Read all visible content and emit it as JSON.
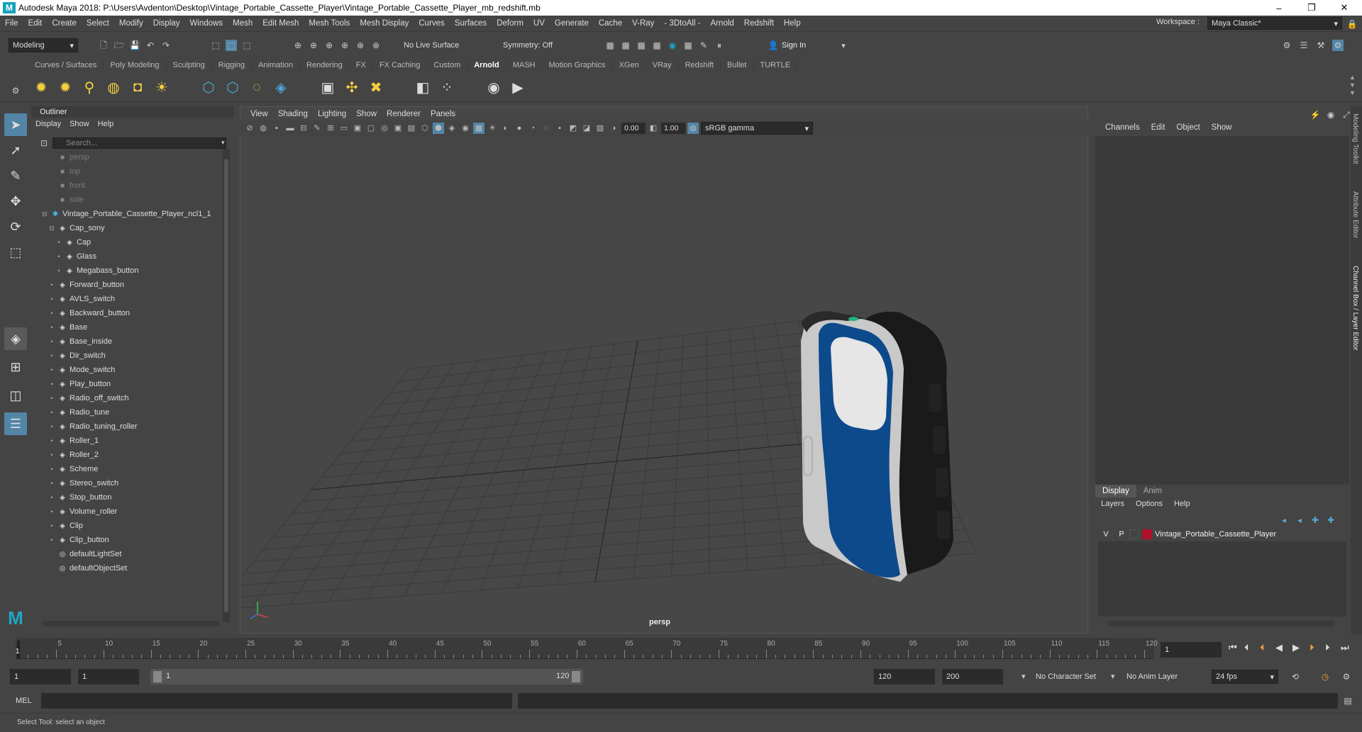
{
  "window": {
    "title": "Autodesk Maya 2018: P:\\Users\\Avdenton\\Desktop\\Vintage_Portable_Cassette_Player\\Vintage_Portable_Cassette_Player_mb_redshift.mb",
    "minimize": "–",
    "maximize": "❐",
    "close": "✕"
  },
  "menubar": [
    "File",
    "Edit",
    "Create",
    "Select",
    "Modify",
    "Display",
    "Windows",
    "Mesh",
    "Edit Mesh",
    "Mesh Tools",
    "Mesh Display",
    "Curves",
    "Surfaces",
    "Deform",
    "UV",
    "Generate",
    "Cache",
    "V-Ray",
    "- 3DtoAll -",
    "Arnold",
    "Redshift",
    "Help"
  ],
  "status": {
    "mode": "Modeling",
    "live_surface": "No Live Surface",
    "symmetry": "Symmetry: Off",
    "sign_in": "Sign In",
    "workspace_label": "Workspace :",
    "workspace_value": "Maya Classic*"
  },
  "shelf_tabs": [
    "Curves / Surfaces",
    "Poly Modeling",
    "Sculpting",
    "Rigging",
    "Animation",
    "Rendering",
    "FX",
    "FX Caching",
    "Custom",
    "Arnold",
    "MASH",
    "Motion Graphics",
    "XGen",
    "VRay",
    "Redshift",
    "Bullet",
    "TURTLE"
  ],
  "shelf_active": "Arnold",
  "outliner": {
    "title": "Outliner",
    "menu": [
      "Display",
      "Show",
      "Help"
    ],
    "search_placeholder": "Search...",
    "items": [
      {
        "label": "persp",
        "indent": 0,
        "kind": "camera",
        "dim": true
      },
      {
        "label": "top",
        "indent": 0,
        "kind": "camera",
        "dim": true
      },
      {
        "label": "front",
        "indent": 0,
        "kind": "camera",
        "dim": true
      },
      {
        "label": "side",
        "indent": 0,
        "kind": "camera",
        "dim": true
      },
      {
        "label": "Vintage_Portable_Cassette_Player_ncl1_1",
        "indent": 0,
        "kind": "group",
        "expand": "minus"
      },
      {
        "label": "Cap_sony",
        "indent": 1,
        "kind": "mesh",
        "expand": "minus"
      },
      {
        "label": "Cap",
        "indent": 2,
        "kind": "mesh"
      },
      {
        "label": "Glass",
        "indent": 2,
        "kind": "mesh"
      },
      {
        "label": "Megabass_button",
        "indent": 2,
        "kind": "mesh"
      },
      {
        "label": "Forward_button",
        "indent": 1,
        "kind": "mesh"
      },
      {
        "label": "AVLS_switch",
        "indent": 1,
        "kind": "mesh"
      },
      {
        "label": "Backward_button",
        "indent": 1,
        "kind": "mesh"
      },
      {
        "label": "Base",
        "indent": 1,
        "kind": "mesh"
      },
      {
        "label": "Base_inside",
        "indent": 1,
        "kind": "mesh"
      },
      {
        "label": "Dir_switch",
        "indent": 1,
        "kind": "mesh"
      },
      {
        "label": "Mode_switch",
        "indent": 1,
        "kind": "mesh"
      },
      {
        "label": "Play_button",
        "indent": 1,
        "kind": "mesh"
      },
      {
        "label": "Radio_off_switch",
        "indent": 1,
        "kind": "mesh"
      },
      {
        "label": "Radio_tune",
        "indent": 1,
        "kind": "mesh"
      },
      {
        "label": "Radio_tuning_roller",
        "indent": 1,
        "kind": "mesh"
      },
      {
        "label": "Roller_1",
        "indent": 1,
        "kind": "mesh"
      },
      {
        "label": "Roller_2",
        "indent": 1,
        "kind": "mesh"
      },
      {
        "label": "Scheme",
        "indent": 1,
        "kind": "mesh"
      },
      {
        "label": "Stereo_switch",
        "indent": 1,
        "kind": "mesh"
      },
      {
        "label": "Stop_button",
        "indent": 1,
        "kind": "mesh"
      },
      {
        "label": "Volume_roller",
        "indent": 1,
        "kind": "mesh"
      },
      {
        "label": "Clip",
        "indent": 1,
        "kind": "mesh"
      },
      {
        "label": "Clip_button",
        "indent": 1,
        "kind": "mesh"
      },
      {
        "label": "defaultLightSet",
        "indent": 0,
        "kind": "set"
      },
      {
        "label": "defaultObjectSet",
        "indent": 0,
        "kind": "set"
      }
    ]
  },
  "viewport": {
    "menu": [
      "View",
      "Shading",
      "Lighting",
      "Show",
      "Renderer",
      "Panels"
    ],
    "exposure": "0.00",
    "gamma": "1.00",
    "color_space": "sRGB gamma",
    "camera_label": "persp",
    "model_colors": {
      "body": "#0d4a8c",
      "side": "#1a1a1a",
      "silver": "#c9c9c9",
      "window": "#e6e6e6",
      "led": "#1fb27a"
    }
  },
  "channel_box": {
    "menu": [
      "Channels",
      "Edit",
      "Object",
      "Show"
    ]
  },
  "layer_editor": {
    "tabs": [
      "Display",
      "Anim"
    ],
    "active_tab": "Display",
    "menu": [
      "Layers",
      "Options",
      "Help"
    ],
    "layer": {
      "v": "V",
      "p": "P",
      "name": "Vintage_Portable_Cassette_Player",
      "color": "#b0102a"
    }
  },
  "side_tabs": [
    "Modeling Toolkit",
    "Attribute Editor",
    "Channel Box / Layer Editor"
  ],
  "timeline": {
    "start": 1,
    "end": 120,
    "ticks": [
      5,
      10,
      15,
      20,
      25,
      30,
      35,
      40,
      45,
      50,
      55,
      60,
      65,
      70,
      75,
      80,
      85,
      90,
      95,
      100,
      105,
      110,
      115,
      120
    ],
    "current_frame": "1"
  },
  "range": {
    "start": "1",
    "playback_start": "1",
    "slider_start": "1",
    "slider_end": "120",
    "playback_end": "120",
    "end": "200",
    "character_set": "No Character Set",
    "anim_layer": "No Anim Layer",
    "fps": "24 fps"
  },
  "command_line": {
    "lang": "MEL"
  },
  "help_line": "Select Tool: select an object"
}
